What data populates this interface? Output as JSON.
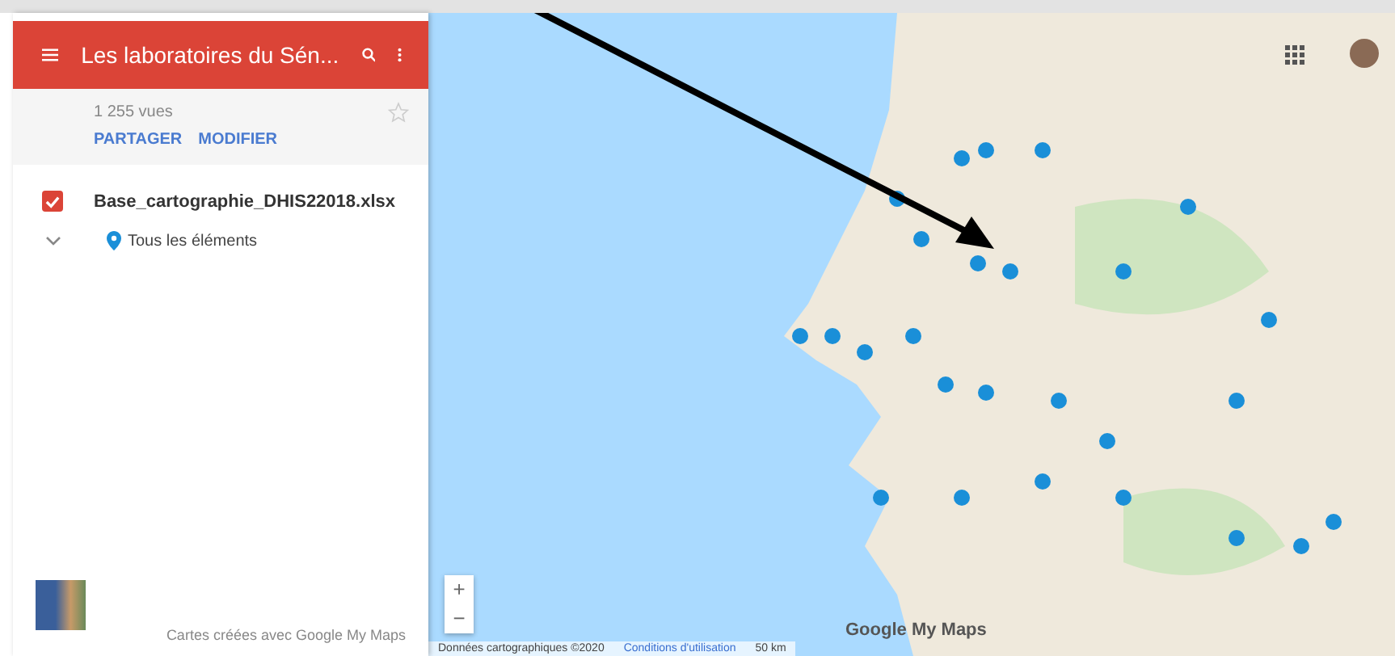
{
  "panel": {
    "title": "Les laboratoires du Sén...",
    "views": "1 255 vues",
    "actions": [
      "PARTAGER",
      "MODIFIER"
    ],
    "starred": false,
    "layers": [
      {
        "name": "Base_cartographie_DHIS22018.xlsx",
        "checked": true,
        "expanded": true,
        "children": [
          {
            "name": "Tous les éléments"
          }
        ]
      }
    ],
    "footer": "Cartes créées avec Google My Maps"
  },
  "map": {
    "zoom_in": "+",
    "zoom_out": "−",
    "logo": "Google My Maps",
    "attribution": [
      {
        "text": "Données cartographiques ©2020",
        "kind": "plain"
      },
      {
        "text": "Conditions d'utilisation",
        "kind": "link"
      },
      {
        "text": "50 km",
        "kind": "scale"
      }
    ]
  }
}
